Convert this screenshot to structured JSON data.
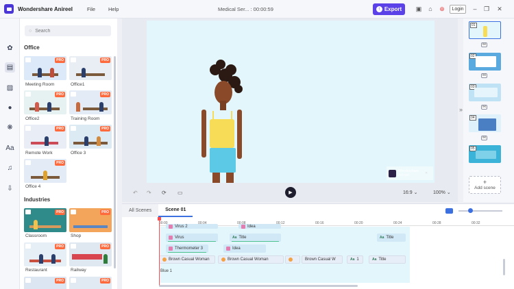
{
  "app": {
    "name": "Wondershare Anireel"
  },
  "menu": {
    "file": "File",
    "help": "Help"
  },
  "document": {
    "title": "Medical Ser... : 00:00:59"
  },
  "toolbar": {
    "export_label": "Export",
    "login_label": "Login",
    "export_icon": "arrow-up-circle-icon"
  },
  "colors": {
    "accent": "#5b42e8",
    "pro_badge": "#ff6a3d",
    "playhead": "#ff4d4d",
    "selection": "#3c6fe0"
  },
  "rail": {
    "icons": [
      "palette-icon",
      "template-icon",
      "background-icon",
      "character-icon",
      "prop-icon",
      "text-icon",
      "music-icon",
      "import-icon"
    ],
    "active": "template-icon"
  },
  "library": {
    "search_placeholder": "Search",
    "sections": [
      {
        "title": "Office",
        "items": [
          {
            "label": "Meeting Room",
            "pro": "PRO"
          },
          {
            "label": "Office1",
            "pro": "PRO"
          },
          {
            "label": "Office2",
            "pro": "PRO"
          },
          {
            "label": "Training Room",
            "pro": "PRO"
          },
          {
            "label": "Remote Work",
            "pro": "PRO"
          },
          {
            "label": "Office 3",
            "pro": "PRO"
          },
          {
            "label": "Office 4",
            "pro": "PRO"
          }
        ]
      },
      {
        "title": "Industries",
        "items": [
          {
            "label": "Classroom",
            "pro": "PRO"
          },
          {
            "label": "Shop",
            "pro": "PRO"
          },
          {
            "label": "Restaurant",
            "pro": "PRO"
          },
          {
            "label": "Railway",
            "pro": "PRO"
          },
          {
            "label": "",
            "pro": "PRO"
          },
          {
            "label": "",
            "pro": "PRO"
          }
        ]
      }
    ]
  },
  "watermark": {
    "line1": "Wondershare",
    "line2": "Anireel"
  },
  "player": {
    "ratio": "16:9",
    "zoom": "100%"
  },
  "scenes": {
    "items": [
      "01",
      "02",
      "03",
      "04",
      "05"
    ],
    "active": "01",
    "add_label": "Add scene"
  },
  "timeline": {
    "tabs": [
      "All Scenes",
      "Scene 01"
    ],
    "active_tab": "Scene 01",
    "ruler": [
      "00:00",
      "00:04",
      "00:08",
      "00:12",
      "00:16",
      "00:20",
      "00:24",
      "00:28",
      "00:32"
    ],
    "tracks": [
      [
        "Virus 2",
        "Idea"
      ],
      [
        "Virus",
        "Title",
        "Title"
      ],
      [
        "Thermometer 3",
        "Idea"
      ],
      [
        "Brown Casual Woman",
        "Brown Casual Woman",
        "Brown Casual W",
        "1",
        "Title"
      ]
    ],
    "bg_label": "Blue 1",
    "zoom_level": 0.25
  }
}
